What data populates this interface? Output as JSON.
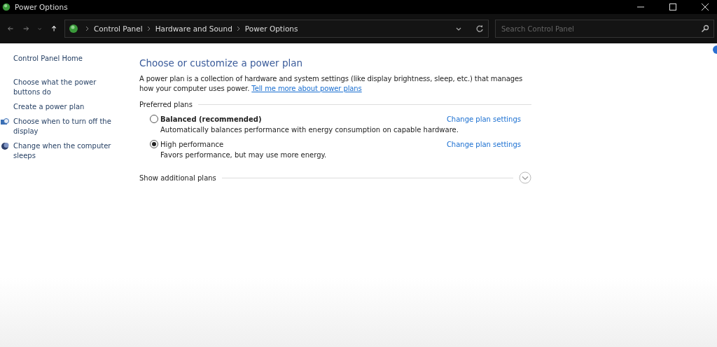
{
  "window": {
    "title": "Power Options"
  },
  "address_bar": {
    "breadcrumbs": [
      "Control Panel",
      "Hardware and Sound",
      "Power Options"
    ]
  },
  "search": {
    "placeholder": "Search Control Panel"
  },
  "sidebar": {
    "items": [
      {
        "label": "Control Panel Home",
        "kind": "home"
      },
      {
        "label": "Choose what the power buttons do",
        "kind": "link"
      },
      {
        "label": "Create a power plan",
        "kind": "link"
      },
      {
        "label": "Choose when to turn off the display",
        "kind": "display"
      },
      {
        "label": "Change when the computer sleeps",
        "kind": "sleep"
      }
    ]
  },
  "heading": "Choose or customize a power plan",
  "intro": "A power plan is a collection of hardware and system settings (like display brightness, sleep, etc.) that manages how your computer uses power.",
  "intro_link": "Tell me more about power plans",
  "section": "Preferred plans",
  "plans": [
    {
      "name": "Balanced (recommended)",
      "emphasized": true,
      "selected": false,
      "description": "Automatically balances performance with energy consumption on capable hardware.",
      "action": "Change plan settings"
    },
    {
      "name": "High performance",
      "emphasized": false,
      "selected": true,
      "description": "Favors performance, but may use more energy.",
      "action": "Change plan settings"
    }
  ],
  "more_plans": {
    "label": "Show additional plans",
    "expanded": false
  }
}
